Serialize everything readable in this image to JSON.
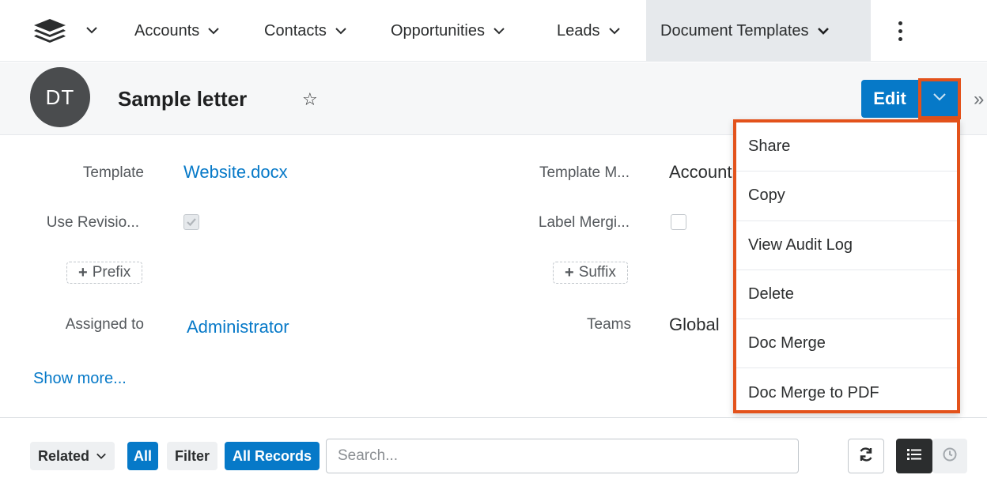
{
  "nav": {
    "items": [
      {
        "label": "Accounts"
      },
      {
        "label": "Contacts"
      },
      {
        "label": "Opportunities"
      },
      {
        "label": "Leads"
      },
      {
        "label": "Document Templates"
      }
    ]
  },
  "record": {
    "avatar_initials": "DT",
    "title": "Sample letter",
    "edit_label": "Edit",
    "collapse_glyph": "»"
  },
  "fields": {
    "template_label": "Template",
    "template_value": "Website.docx",
    "template_module_label": "Template M...",
    "template_module_value": "Accounts",
    "use_revision_label": "Use Revisio...",
    "use_revision_checked": true,
    "label_merging_label": "Label Mergi...",
    "label_merging_checked": false,
    "prefix_label": "Prefix",
    "suffix_label": "Suffix",
    "assigned_label": "Assigned to",
    "assigned_value": "Administrator",
    "teams_label": "Teams",
    "teams_value": "Global",
    "show_more": "Show more..."
  },
  "actions_menu": {
    "items": [
      {
        "label": "Share"
      },
      {
        "label": "Copy"
      },
      {
        "label": "View Audit Log"
      },
      {
        "label": "Delete"
      },
      {
        "label": "Doc Merge"
      },
      {
        "label": "Doc Merge to PDF"
      }
    ]
  },
  "toolbar": {
    "related_label": "Related",
    "all_label": "All",
    "filter_label": "Filter",
    "all_records_label": "All Records",
    "search_placeholder": "Search..."
  },
  "colors": {
    "accent": "#0679c8",
    "highlight": "#e3521b",
    "avatar": "#4a4c4e"
  }
}
